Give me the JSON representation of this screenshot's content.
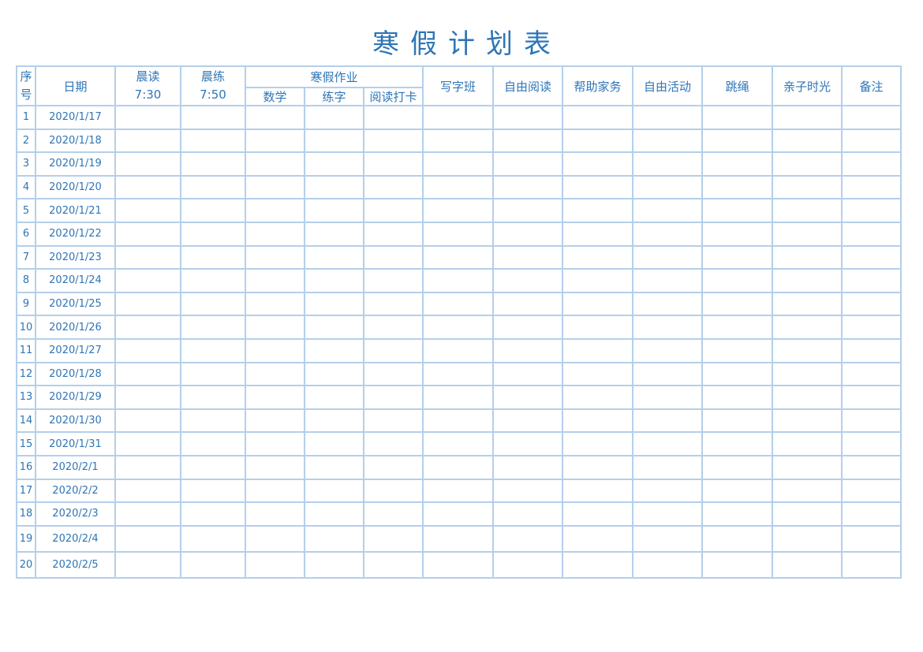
{
  "title": "寒假计划表",
  "headers": {
    "seq": [
      "序",
      "号"
    ],
    "date": "日期",
    "morning_read": [
      "晨读",
      "7:30"
    ],
    "morning_practice": [
      "晨练",
      "7:50"
    ],
    "homework_group": "寒假作业",
    "homework_sub": [
      "数学",
      "练字",
      "阅读打卡"
    ],
    "others": [
      "写字班",
      "自由阅读",
      "帮助家务",
      "自由活动",
      "跳绳",
      "亲子时光",
      "备注"
    ]
  },
  "rows": [
    {
      "n": "1",
      "date": "2020/1/17"
    },
    {
      "n": "2",
      "date": "2020/1/18"
    },
    {
      "n": "3",
      "date": "2020/1/19"
    },
    {
      "n": "4",
      "date": "2020/1/20"
    },
    {
      "n": "5",
      "date": "2020/1/21"
    },
    {
      "n": "6",
      "date": "2020/1/22"
    },
    {
      "n": "7",
      "date": "2020/1/23"
    },
    {
      "n": "8",
      "date": "2020/1/24"
    },
    {
      "n": "9",
      "date": "2020/1/25"
    },
    {
      "n": "10",
      "date": "2020/1/26"
    },
    {
      "n": "11",
      "date": "2020/1/27"
    },
    {
      "n": "12",
      "date": "2020/1/28"
    },
    {
      "n": "13",
      "date": "2020/1/29"
    },
    {
      "n": "14",
      "date": "2020/1/30"
    },
    {
      "n": "15",
      "date": "2020/1/31"
    },
    {
      "n": "16",
      "date": "2020/2/1"
    },
    {
      "n": "17",
      "date": "2020/2/2"
    },
    {
      "n": "18",
      "date": "2020/2/3"
    },
    {
      "n": "19",
      "date": "2020/2/4"
    },
    {
      "n": "20",
      "date": "2020/2/5"
    }
  ],
  "colors": {
    "text": "#2e75b6",
    "grid": "#b4cfea"
  }
}
